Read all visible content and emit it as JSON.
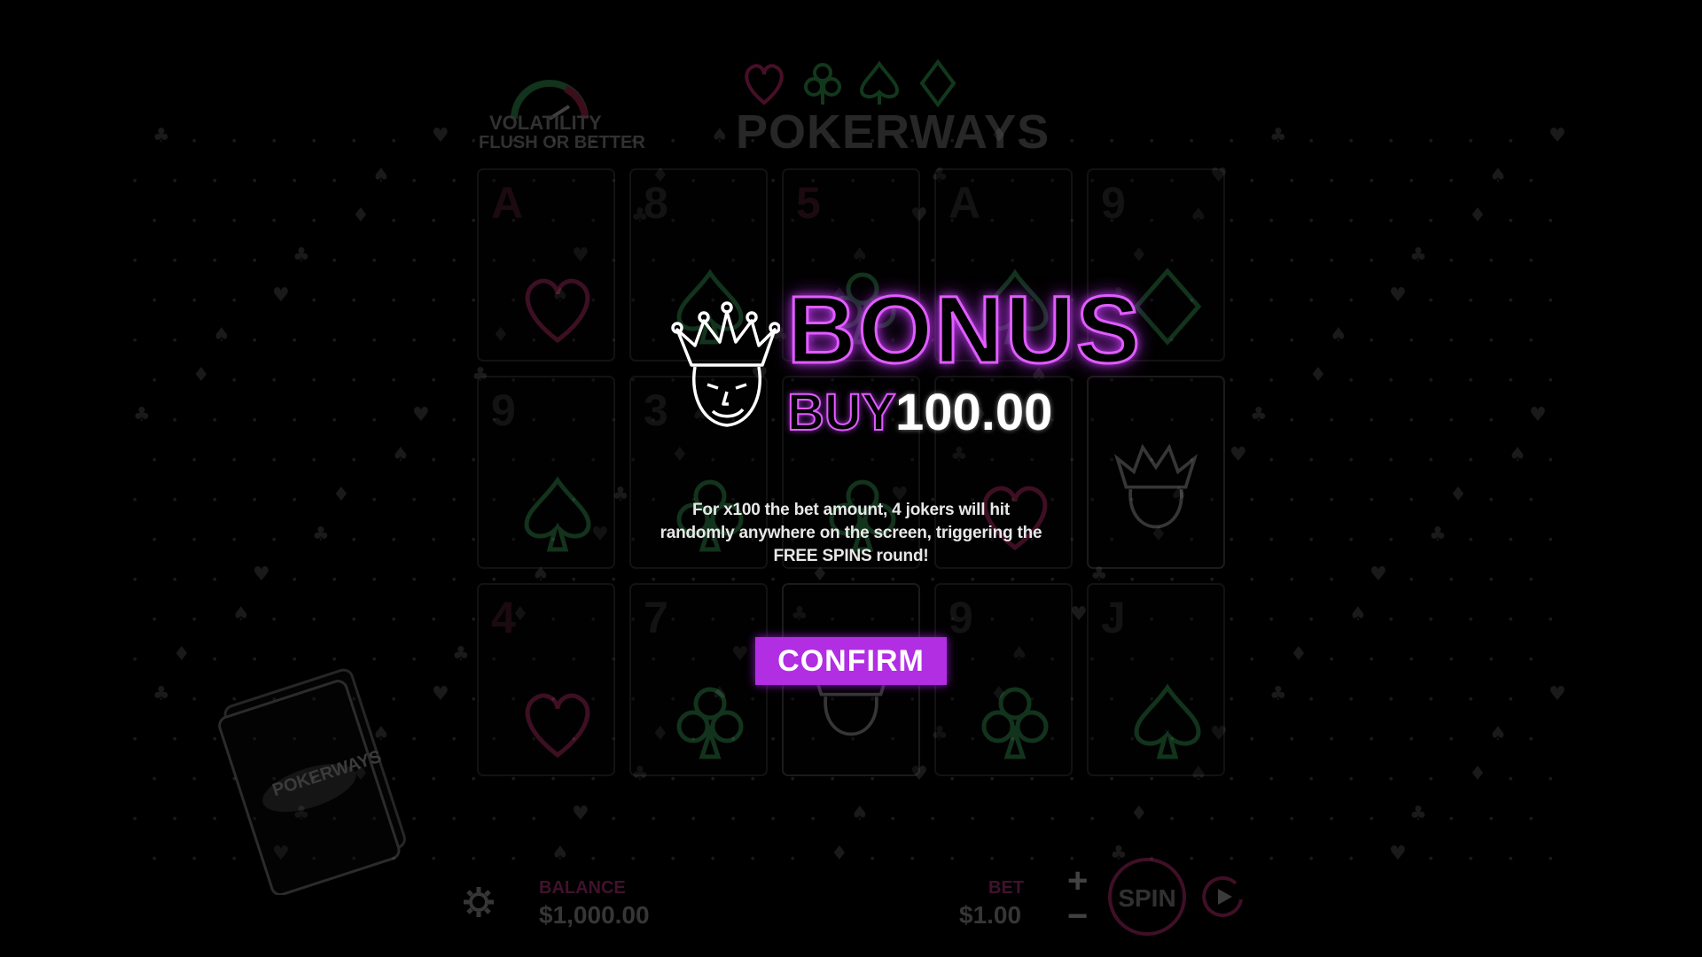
{
  "game": {
    "title": "POKERWAYS",
    "volatility_label": "VOLATILITY",
    "volatility_sub": "FLUSH OR BETTER",
    "deck_label": "POKERWAYS"
  },
  "reels": [
    {
      "rank": "A",
      "suit": "heart",
      "red": true
    },
    {
      "rank": "8",
      "suit": "spade",
      "red": false
    },
    {
      "rank": "5",
      "suit": "club",
      "red": true
    },
    {
      "rank": "A",
      "suit": "spade",
      "red": false
    },
    {
      "rank": "9",
      "suit": "diamond",
      "red": false
    },
    {
      "rank": "9",
      "suit": "spade",
      "red": false
    },
    {
      "rank": "3",
      "suit": "club",
      "red": false
    },
    {
      "rank": "",
      "suit": "club",
      "red": false
    },
    {
      "rank": "",
      "suit": "heart",
      "red": true
    },
    {
      "rank": "",
      "suit": "joker",
      "red": false
    },
    {
      "rank": "4",
      "suit": "heart",
      "red": true
    },
    {
      "rank": "7",
      "suit": "club",
      "red": false
    },
    {
      "rank": "",
      "suit": "joker",
      "red": false
    },
    {
      "rank": "9",
      "suit": "club",
      "red": false
    },
    {
      "rank": "J",
      "suit": "spade",
      "red": false
    }
  ],
  "hud": {
    "balance_label": "BALANCE",
    "balance_value": "$1,000.00",
    "bet_label": "BET",
    "bet_value": "$1.00",
    "plus": "+",
    "minus": "−",
    "spin_label": "SPIN"
  },
  "bonus_popup": {
    "title": "BONUS",
    "buy_label": "BUY",
    "amount": "100.00",
    "description": "For x100 the bet amount, 4 jokers will hit randomly anywhere on the screen, triggering the FREE SPINS round!",
    "confirm_label": "CONFIRM"
  },
  "colors": {
    "accent": "#b12ee3",
    "neon": "#e05cff",
    "background": "#000000"
  }
}
